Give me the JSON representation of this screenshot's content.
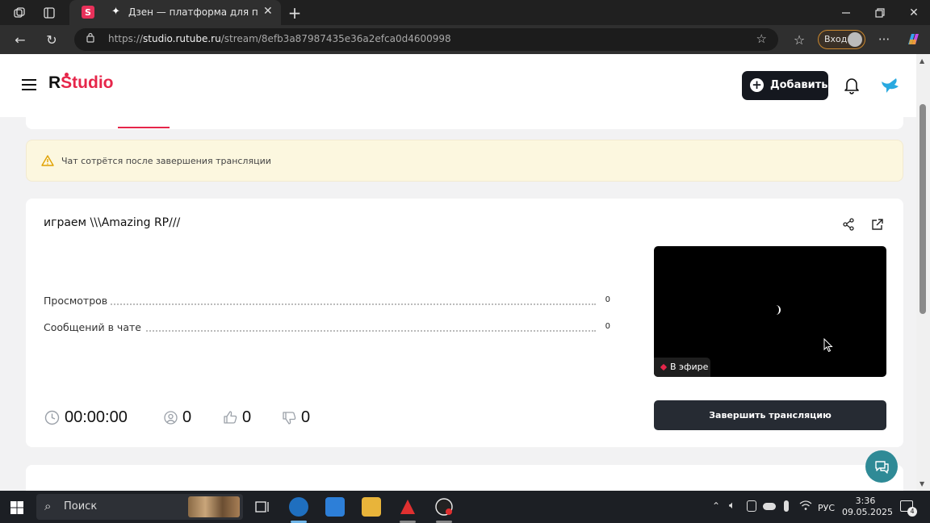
{
  "browser": {
    "tab_title": "Дзен — платформа для просмот",
    "url_prefix": "https://",
    "url_domain": "studio.rutube.ru",
    "url_path": "/stream/8efb3a87987435e36a2efca0d4600998",
    "login_label": "Вход"
  },
  "header": {
    "logo_r": "R",
    "logo_studio": "Studio",
    "add_button_label": "Добавить"
  },
  "warning": {
    "text": "Чат сотрётся после завершения трансляции"
  },
  "stream": {
    "title": "играем \\\\\\Amazing RP///",
    "stats": [
      {
        "label": "Просмотров",
        "value": "0"
      },
      {
        "label": "Сообщений в чате",
        "value": "0"
      }
    ],
    "live_badge": "В эфире",
    "end_button_label": "Завершить трансляцию",
    "duration": "00:00:00",
    "viewers": "0",
    "likes": "0",
    "dislikes": "0"
  },
  "taskbar": {
    "search_placeholder": "Поиск",
    "language": "РУС",
    "time": "3:36",
    "date": "09.05.2025",
    "notification_count": "4"
  },
  "colors": {
    "brand_red": "#e6264a",
    "dark_button": "#15181f",
    "warning_bg": "#fcf7df",
    "chat_fab": "#2f8a96"
  }
}
